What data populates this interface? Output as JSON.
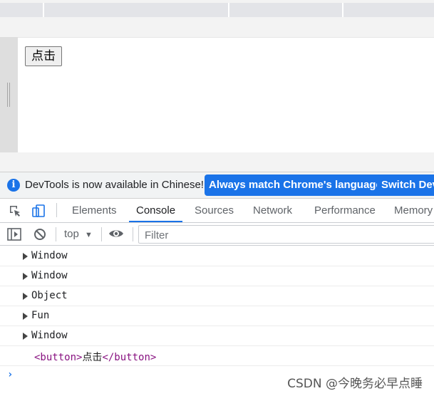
{
  "page": {
    "button_label": "点击"
  },
  "infobar": {
    "message": "DevTools is now available in Chinese!",
    "match_button": "Always match Chrome's language",
    "switch_button": "Switch Dev"
  },
  "tabs": [
    {
      "label": "Elements"
    },
    {
      "label": "Console"
    },
    {
      "label": "Sources"
    },
    {
      "label": "Network"
    },
    {
      "label": "Performance"
    },
    {
      "label": "Memory"
    }
  ],
  "active_tab": "Console",
  "console_toolbar": {
    "context": "top",
    "filter_placeholder": "Filter"
  },
  "console_messages": [
    {
      "text": "Window",
      "expandable": true
    },
    {
      "text": "Window",
      "expandable": true
    },
    {
      "text": "Object",
      "expandable": true
    },
    {
      "text": "Fun",
      "expandable": true
    },
    {
      "text": "Window",
      "expandable": true
    }
  ],
  "html_output": {
    "open_tag": "<button>",
    "content": "点击",
    "close_tag": "</button>"
  },
  "prompt_symbol": "›",
  "watermark": "CSDN @今晚务必早点睡",
  "colors": {
    "accent": "#1a73e8",
    "tag_purple": "#881280"
  }
}
